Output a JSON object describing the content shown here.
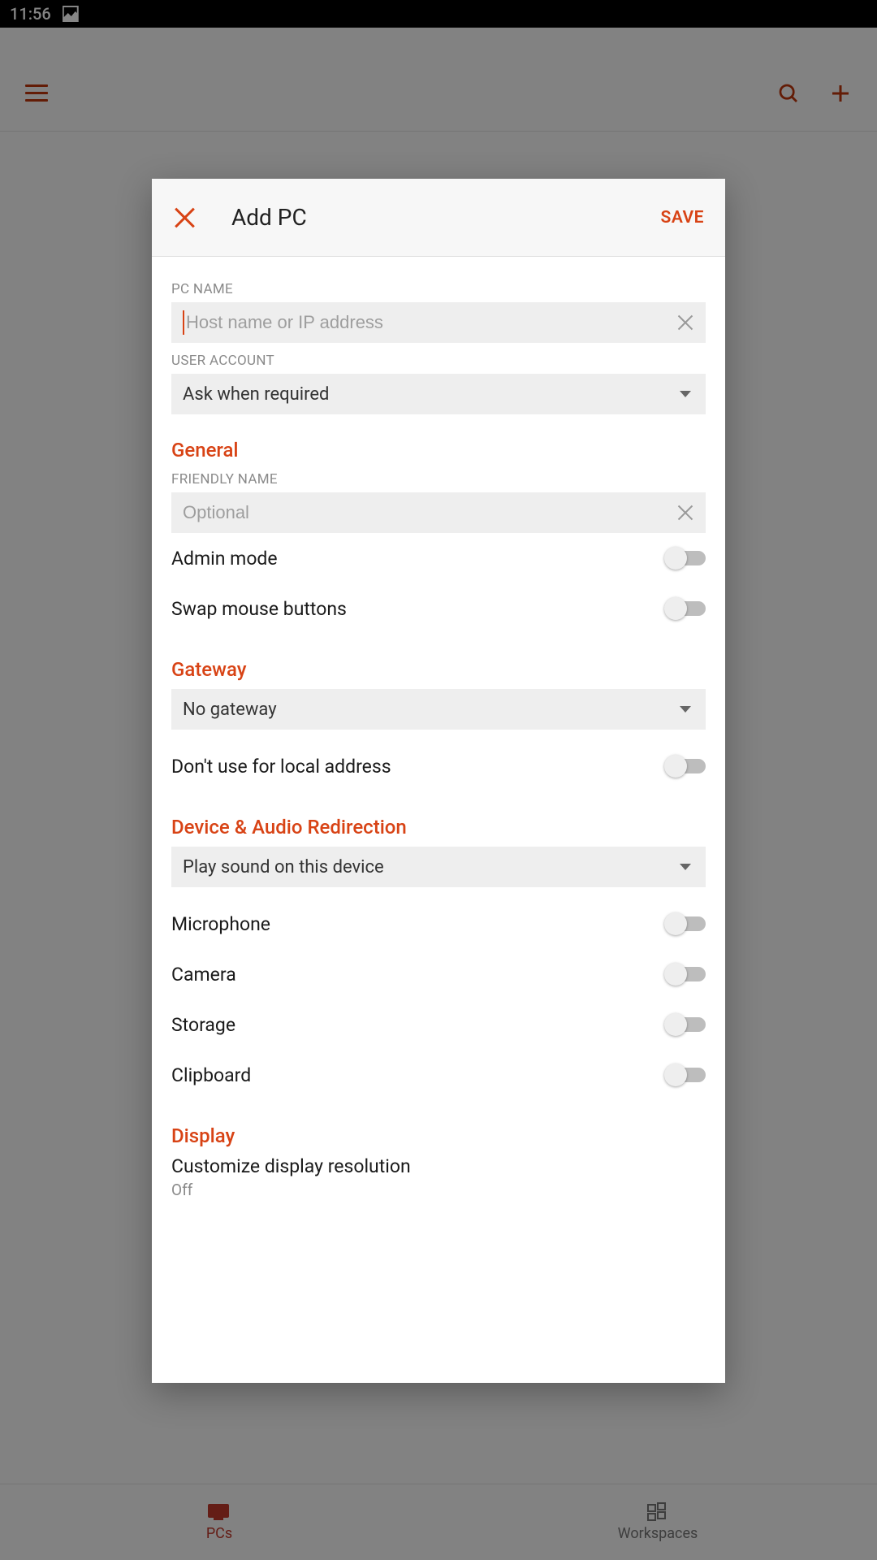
{
  "status": {
    "time": "11:56"
  },
  "bottom_nav": {
    "pcs": "PCs",
    "workspaces": "Workspaces"
  },
  "dialog": {
    "title": "Add PC",
    "save": "SAVE",
    "pc_name_label": "PC NAME",
    "pc_name_placeholder": "Host name or IP address",
    "pc_name_value": "",
    "user_account_label": "USER ACCOUNT",
    "user_account_value": "Ask when required",
    "sections": {
      "general": "General",
      "gateway": "Gateway",
      "device_audio": "Device & Audio Redirection",
      "display": "Display"
    },
    "friendly_name_label": "FRIENDLY NAME",
    "friendly_name_placeholder": "Optional",
    "friendly_name_value": "",
    "toggles": {
      "admin_mode": "Admin mode",
      "swap_mouse": "Swap mouse buttons",
      "dont_use_local": "Don't use for local address",
      "microphone": "Microphone",
      "camera": "Camera",
      "storage": "Storage",
      "clipboard": "Clipboard"
    },
    "gateway_value": "No gateway",
    "sound_value": "Play sound on this device",
    "display_res_label": "Customize display resolution",
    "display_res_value": "Off"
  }
}
